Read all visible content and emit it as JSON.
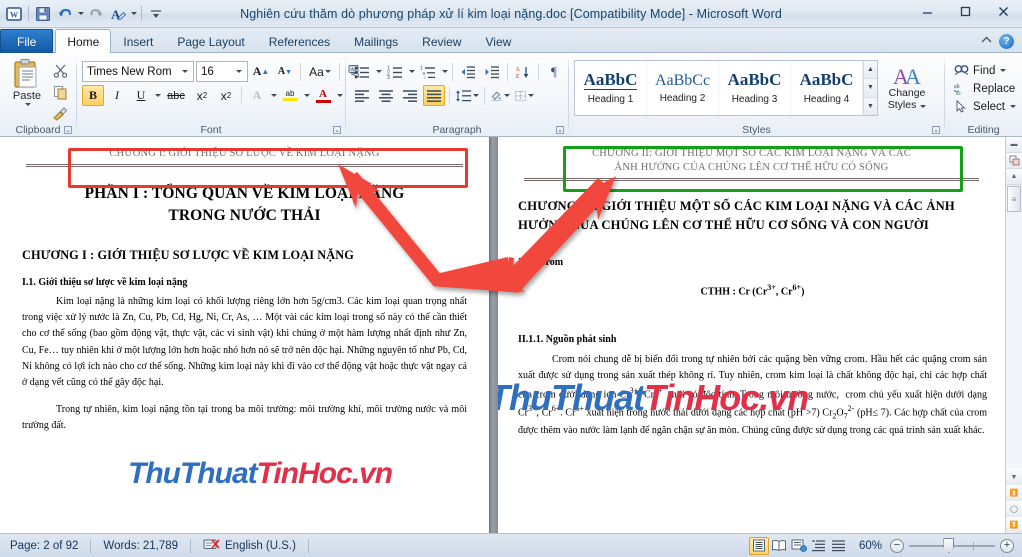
{
  "window": {
    "title": "Nghiên cứu thăm dò phương pháp xử lí kim loại nặng.doc [Compatibility Mode]  -  Microsoft Word",
    "minimize": "–",
    "maximize": "□",
    "close": "✕",
    "help_label": "?"
  },
  "qat": {
    "app_icon": "word-icon",
    "items": [
      {
        "name": "save-icon",
        "label": "Save"
      },
      {
        "name": "undo-icon",
        "label": "Undo"
      },
      {
        "name": "redo-icon",
        "label": "Redo"
      },
      {
        "name": "format-painter-style-icon",
        "label": "Styles"
      },
      {
        "name": "customize-qat-icon",
        "label": "Customize Quick Access Toolbar"
      }
    ]
  },
  "tabs": [
    {
      "id": "file",
      "label": "File"
    },
    {
      "id": "home",
      "label": "Home"
    },
    {
      "id": "insert",
      "label": "Insert"
    },
    {
      "id": "pagelayout",
      "label": "Page Layout"
    },
    {
      "id": "references",
      "label": "References"
    },
    {
      "id": "mailings",
      "label": "Mailings"
    },
    {
      "id": "review",
      "label": "Review"
    },
    {
      "id": "view",
      "label": "View"
    }
  ],
  "ribbon": {
    "clipboard": {
      "label": "Clipboard",
      "paste": "Paste",
      "cut": "Cut",
      "copy": "Copy",
      "format_painter": "Format Painter"
    },
    "font": {
      "label": "Font",
      "font_name": "Times New Rom",
      "font_size": "16",
      "grow": "A",
      "shrink": "A",
      "change_case": "Aa",
      "clear_formatting": "Clear Formatting",
      "bold": "B",
      "italic": "I",
      "underline": "U",
      "strikethrough": "abc",
      "subscript": "x",
      "superscript": "x",
      "text_effects": "A",
      "highlight": "ab",
      "font_color": "A"
    },
    "paragraph": {
      "label": "Paragraph",
      "bullets": "Bullets",
      "numbering": "Numbering",
      "multilevel": "Multilevel List",
      "decrease_indent": "Decrease Indent",
      "increase_indent": "Increase Indent",
      "sort": "Sort",
      "show_marks": "¶",
      "align_left": "Align Left",
      "align_center": "Center",
      "align_right": "Align Right",
      "justify": "Justify",
      "line_spacing": "Line and Paragraph Spacing",
      "shading": "Shading",
      "borders": "Borders"
    },
    "styles": {
      "label": "Styles",
      "items": [
        {
          "preview": "AaBbC",
          "name": "Heading 1"
        },
        {
          "preview": "AaBbCc",
          "name": "Heading 2"
        },
        {
          "preview": "AaBbC",
          "name": "Heading 3"
        },
        {
          "preview": "AaBbC",
          "name": "Heading 4"
        }
      ],
      "change_styles_line1": "Change",
      "change_styles_line2": "Styles"
    },
    "editing": {
      "label": "Editing",
      "find": "Find",
      "replace": "Replace",
      "select": "Select"
    }
  },
  "document": {
    "left_page": {
      "header": "CHƯƠNG I: GIỚI THIỆU SƠ LƯỢC VỀ KIM LOẠI NẶNG",
      "title_line1": "PHẦN I : TỔNG QUAN VỀ KIM LOẠI NẶNG",
      "title_line2": "TRONG NƯỚC THẢI",
      "chapter": "CHƯƠNG I : GIỚI THIỆU SƠ LƯỢC VỀ KIM LOẠI NẶNG",
      "section": "I.1. Giới thiệu sơ lược về kim loại nặng",
      "para1": "Kim loại nặng là những kim loại có khối lượng riêng lớn hơn 5g/cm3. Các kim loại quan trọng nhất trong việc xử lý  nước là Zn, Cu, Pb, Cd, Hg, Ni, Cr, As, …  Một vài các kim loại trong số này có thể cần thiết cho cơ thể sống (bao gồm động vật, thực vật, các vi sinh vật) khi chúng ở một hàm lượng nhất định như Zn, Cu, Fe… tuy nhiên khi ở một lượng lớn hơn hoặc nhỏ hơn nó sẽ trở nên độc hại. Những nguyên tố như Pb, Cd, Ni không có lợi ích nào cho cơ thể sống. Những kim loại này khi đi vào cơ thể động vật hoặc thực vật ngay cả ở dạng vết cũng có thể gây độc hại.",
      "para2": "Trong tự nhiên, kim loại nặng tồn tại trong ba môi trường: môi trường khí, môi trường nước và môi trường đất."
    },
    "right_page": {
      "header_line1": "CHƯƠNG II: GIỚI THIỆU MỘT SỐ CÁC KIM LOẠI NẶNG VÀ CÁC",
      "header_line2": "ẢNH HƯỞNG CỦA CHÚNG LÊN CƠ THỂ HỮU CÓ SỐNG",
      "chapter": "CHƯƠNG II :  GIỚI THIỆU MỘT SỐ CÁC KIM LOẠI NẶNG VÀ CÁC ẢNH HƯỞNG CỦA CHÚNG LÊN CƠ THỂ HỮU CƠ SỐNG VÀ CON NGƯỜI",
      "section1": "II.1. Crom",
      "formula": "CTHH : Cr (Cr3+, Cr6+)",
      "section2": "II.1.1. Nguồn phát sinh",
      "para1": "Crom nói chung dễ bị biến đổi trong tự nhiên bởi các quặng bền vững crom. Hầu hết các quặng crom sản xuất được sử dụng trong sản xuất thép không rỉ. Tuy nhiên, crom kim loại là chất không độc hại, chỉ các hợp chất của crom dưới dạng ion Cr3+, Cr6+  mới có độc tính. Trong môi trường nước,  crom chủ yếu xuất hiện dưới dạng Cr3+, Cr6+. Cr6+ xuất hiện trong nước thải dưới dạng các hợp chất (pH >7) Cr2O72- (pH≤ 7). Các hợp chất của crom được thêm vào nước làm lạnh để ngăn chặn sự ăn mòn. Chúng cũng được sử dụng trong các quá trình sản xuất khác."
    }
  },
  "status": {
    "page": "Page: 2 of 92",
    "words": "Words: 21,789",
    "language": "English (U.S.)",
    "proofing_icon": "spellcheck-icon",
    "zoom": "60%",
    "views": [
      {
        "name": "print-layout",
        "active": true
      },
      {
        "name": "full-screen-reading",
        "active": false
      },
      {
        "name": "web-layout",
        "active": false
      },
      {
        "name": "outline",
        "active": false
      },
      {
        "name": "draft",
        "active": false
      }
    ],
    "zoom_out": "−",
    "zoom_in": "+"
  },
  "watermarks": [
    {
      "text_blue": "ThuThuat",
      "text_red": "TinHoc",
      "suffix": ".vn"
    },
    {
      "text_blue": "ThuThuat",
      "text_red": "TinHoc",
      "suffix": ".vn"
    }
  ],
  "annotations": {
    "red_box_color": "#e8392e",
    "green_box_color": "#15a018",
    "arrow_color": "#f2473c"
  }
}
